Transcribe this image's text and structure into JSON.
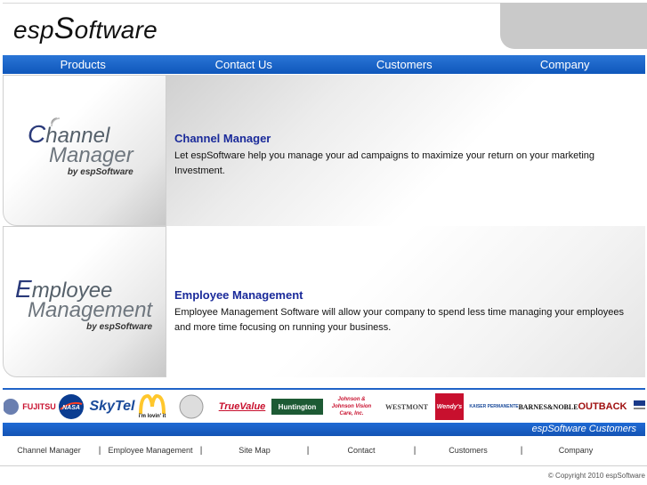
{
  "header": {
    "logo_prefix": "esp",
    "logo_big": "S",
    "logo_suffix": "oftware"
  },
  "nav": {
    "items": [
      "Products",
      "Contact Us",
      "Customers",
      "Company"
    ]
  },
  "products": [
    {
      "logo_line1_cap": "C",
      "logo_line1": "hannel",
      "logo_line2": "Manager",
      "logo_by": "by espSoftware",
      "title": "Channel Manager",
      "description": "Let espSoftware help you manage your ad campaigns to maximize your return on your marketing Investment."
    },
    {
      "logo_line1_cap": "E",
      "logo_line1": "mployee",
      "logo_line2": "Management",
      "logo_by": "by espSoftware",
      "title": "Employee Management",
      "description": "Employee Management Software will allow your company to spend less time managing your employees and more time focusing on running your business."
    }
  ],
  "customers": {
    "logos": [
      "FUJITSU",
      "NASA",
      "SkyTel",
      "i'm lovin' it",
      "TrueValue",
      "Huntington",
      "Johnson & Johnson Vision Care, Inc.",
      "WESTMONT",
      "Wendy's",
      "KAISER PERMANENTE",
      "BARNES&NOBLE",
      "OUTBACK"
    ],
    "caption": "espSoftware Customers"
  },
  "footer": {
    "links": [
      "Channel Manager",
      "Employee Management",
      "Site Map",
      "Contact",
      "Customers",
      "Company"
    ],
    "separator": "|",
    "copyright": "© Copyright 2010 espSoftware"
  },
  "colors": {
    "nav_blue": "#1a62c8",
    "title_blue": "#1a2a9a"
  }
}
